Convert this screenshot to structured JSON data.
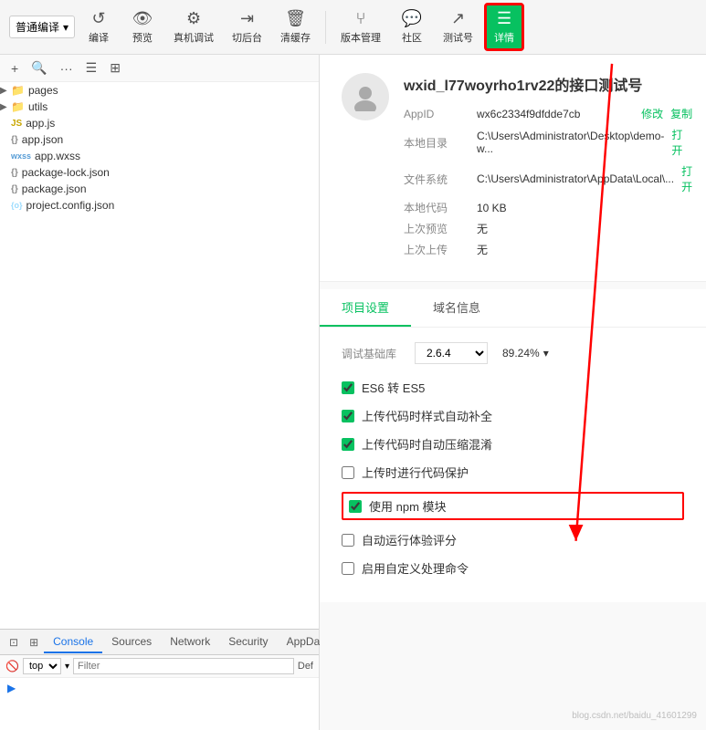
{
  "toolbar": {
    "dropdown_label": "普通编译",
    "btn_compile": "编译",
    "btn_preview": "预览",
    "btn_realdevice": "真机调试",
    "btn_cutback": "切后台",
    "btn_clearcache": "清缓存",
    "btn_versions": "版本管理",
    "btn_community": "社区",
    "btn_testno": "测试号",
    "btn_details": "详情"
  },
  "filetree": {
    "items": [
      {
        "name": "pages",
        "type": "folder",
        "indent": 0
      },
      {
        "name": "utils",
        "type": "folder",
        "indent": 0
      },
      {
        "name": "app.js",
        "type": "js",
        "indent": 0
      },
      {
        "name": "app.json",
        "type": "json",
        "indent": 0
      },
      {
        "name": "app.wxss",
        "type": "wxss",
        "indent": 0
      },
      {
        "name": "package-lock.json",
        "type": "json",
        "indent": 0
      },
      {
        "name": "package.json",
        "type": "json",
        "indent": 0
      },
      {
        "name": "project.config.json",
        "type": "config",
        "indent": 0
      }
    ]
  },
  "console": {
    "tabs": [
      "Console",
      "Sources",
      "Network",
      "Security",
      "AppData"
    ],
    "active_tab": "Console",
    "top_label": "top",
    "filter_placeholder": "Filter",
    "def_label": "Def"
  },
  "profile": {
    "name": "wxid_l77woyrho1rv22的接口测试号",
    "appid_label": "AppID",
    "appid_value": "wx6c2334f9dfdde7cb",
    "appid_modify": "修改",
    "appid_copy": "复制",
    "local_dir_label": "本地目录",
    "local_dir_value": "C:\\Users\\Administrator\\Desktop\\demo-w...",
    "local_dir_open": "打开",
    "filesystem_label": "文件系统",
    "filesystem_value": "C:\\Users\\Administrator\\AppData\\Local\\...",
    "filesystem_open": "打开",
    "local_code_label": "本地代码",
    "local_code_value": "10 KB",
    "last_preview_label": "上次预览",
    "last_preview_value": "无",
    "last_upload_label": "上次上传",
    "last_upload_value": "无"
  },
  "settings": {
    "tab_project": "项目设置",
    "tab_domain": "域名信息",
    "active_tab": "项目设置",
    "debug_lib_label": "调试基础库",
    "debug_lib_version": "2.6.4",
    "debug_lib_pct": "89.24%",
    "checkboxes": [
      {
        "label": "ES6 转 ES5",
        "checked": true
      },
      {
        "label": "上传代码时样式自动补全",
        "checked": true
      },
      {
        "label": "上传代码时自动压缩混淆",
        "checked": true
      },
      {
        "label": "上传时进行代码保护",
        "checked": false
      },
      {
        "label": "使用 npm 模块",
        "checked": true,
        "highlighted": true
      },
      {
        "label": "自动运行体验评分",
        "checked": false
      },
      {
        "label": "启用自定义处理命令",
        "checked": false
      }
    ]
  },
  "watermark": "blog.csdn.net/baidu_41601299"
}
